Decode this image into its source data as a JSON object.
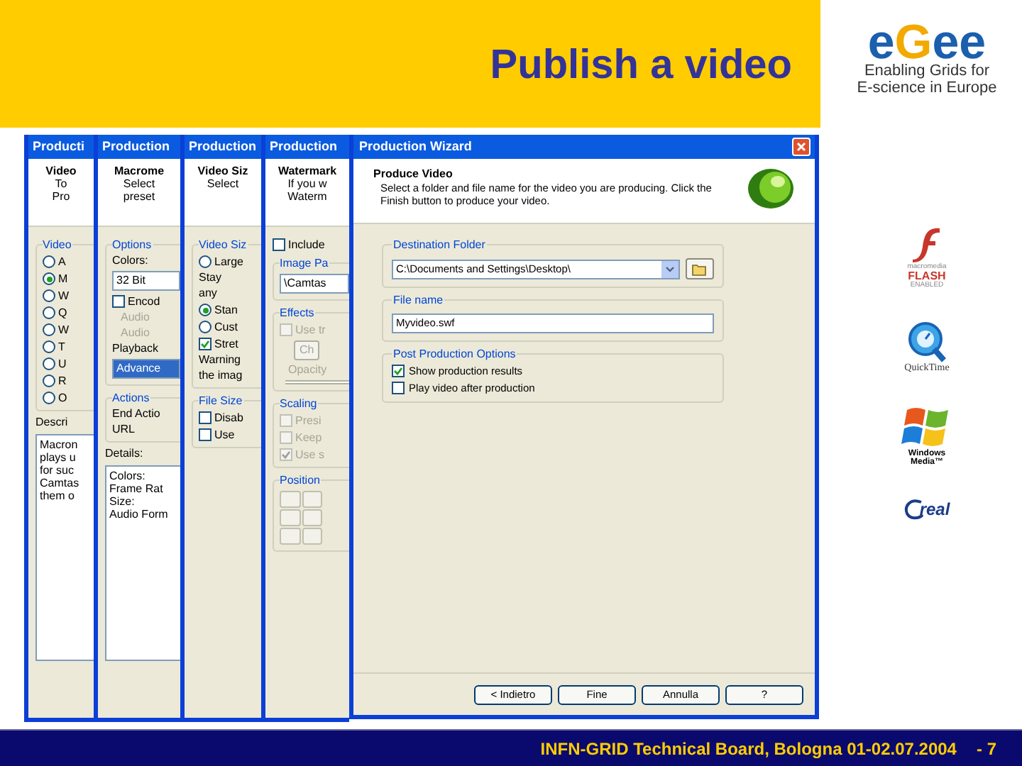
{
  "slide_title": "Publish a video",
  "back_windows": [
    {
      "title": "Producti",
      "header": [
        "Video",
        "To",
        "Pro"
      ],
      "body": [
        {
          "kind": "group",
          "label": "Video",
          "children": [
            {
              "kind": "radio",
              "label": "A",
              "selected": false
            },
            {
              "kind": "radio",
              "label": "M",
              "selected": true
            },
            {
              "kind": "radio",
              "label": "W",
              "selected": false
            },
            {
              "kind": "radio",
              "label": "Q",
              "selected": false
            },
            {
              "kind": "radio",
              "label": "W",
              "selected": false
            },
            {
              "kind": "radio",
              "label": "T",
              "selected": false
            },
            {
              "kind": "radio",
              "label": "U",
              "selected": false
            },
            {
              "kind": "radio",
              "label": "R",
              "selected": false
            },
            {
              "kind": "radio",
              "label": "O",
              "selected": false
            }
          ]
        },
        {
          "kind": "text",
          "label": "Descri"
        },
        {
          "kind": "textbox",
          "lines": [
            "Macron",
            "plays u",
            "for suc",
            "Camtas",
            "them o"
          ]
        }
      ]
    },
    {
      "title": "Production",
      "header": [
        "Macrome",
        "Select",
        "preset"
      ],
      "body": [
        {
          "kind": "group",
          "label": "Options",
          "children": [
            {
              "kind": "text",
              "label": "Colors:"
            },
            {
              "kind": "field",
              "label": "32 Bit",
              "selected": false
            },
            {
              "kind": "checkbox",
              "label": "Encod",
              "checked": false,
              "disabled": false
            },
            {
              "kind": "dimtext",
              "label": "Audio"
            },
            {
              "kind": "dimtext",
              "label": "Audio"
            },
            {
              "kind": "text",
              "label": "Playback"
            },
            {
              "kind": "field",
              "label": "Advance",
              "selected": true
            }
          ]
        },
        {
          "kind": "group",
          "label": "Actions",
          "children": [
            {
              "kind": "text",
              "label": "End Actio"
            },
            {
              "kind": "text",
              "label": "URL"
            }
          ]
        },
        {
          "kind": "text",
          "label": "Details:"
        },
        {
          "kind": "textbox",
          "lines": [
            "Colors:",
            "Frame Rat",
            "Size:",
            "Audio Form"
          ]
        }
      ]
    },
    {
      "title": "Production",
      "header": [
        "Video Siz",
        "Select"
      ],
      "body": [
        {
          "kind": "group",
          "label": "Video Siz",
          "children": [
            {
              "kind": "radio",
              "label": "Large",
              "selected": false
            },
            {
              "kind": "text",
              "label": "Stay"
            },
            {
              "kind": "text",
              "label": "any"
            },
            {
              "kind": "radio",
              "label": "Stan",
              "selected": true
            },
            {
              "kind": "radio",
              "label": "Cust",
              "selected": false
            },
            {
              "kind": "checkbox",
              "label": "Stret",
              "checked": true,
              "disabled": false
            },
            {
              "kind": "text",
              "label": "Warning"
            },
            {
              "kind": "text",
              "label": "the imag"
            }
          ]
        },
        {
          "kind": "group",
          "label": "File Size",
          "children": [
            {
              "kind": "checkbox",
              "label": "Disab",
              "checked": false,
              "disabled": false
            },
            {
              "kind": "checkbox",
              "label": "Use",
              "checked": false,
              "disabled": false
            }
          ]
        }
      ]
    },
    {
      "title": "Production",
      "header": [
        "Watermark",
        "If you w",
        "Waterm"
      ],
      "body": [
        {
          "kind": "checkbox",
          "label": "Include",
          "checked": false,
          "disabled": false
        },
        {
          "kind": "group",
          "label": "Image Pa",
          "children": [
            {
              "kind": "field",
              "label": "\\Camtas",
              "selected": false
            }
          ]
        },
        {
          "kind": "group",
          "label": "Effects",
          "children": [
            {
              "kind": "checkbox",
              "label": "Use tr",
              "checked": false,
              "disabled": true
            },
            {
              "kind": "button",
              "label": "Ch"
            },
            {
              "kind": "dimtext",
              "label": "Opacity"
            },
            {
              "kind": "slider"
            }
          ]
        },
        {
          "kind": "group",
          "label": "Scaling",
          "children": [
            {
              "kind": "checkbox",
              "label": "Presi",
              "checked": false,
              "disabled": true
            },
            {
              "kind": "checkbox",
              "label": "Keep",
              "checked": false,
              "disabled": true
            },
            {
              "kind": "checkbox",
              "label": "Use s",
              "checked": true,
              "disabled": true
            }
          ]
        },
        {
          "kind": "group",
          "label": "Position",
          "children": [
            {
              "kind": "grid"
            }
          ]
        }
      ]
    }
  ],
  "wizard": {
    "title": "Production Wizard",
    "heading": "Produce Video",
    "description": "Select a folder and file name for the video you are producing. Click the Finish button to produce your video.",
    "destination": {
      "label": "Destination Folder",
      "value": "C:\\Documents and Settings\\Desktop\\"
    },
    "file_name": {
      "label": "File name",
      "value": "Myvideo.swf"
    },
    "post_production": {
      "label": "Post Production Options",
      "options": [
        {
          "label": "Show production results",
          "checked": true
        },
        {
          "label": "Play video after production",
          "checked": false
        }
      ]
    },
    "buttons": [
      "< Indietro",
      "Fine",
      "Annulla",
      "?"
    ]
  },
  "logo": {
    "letters": [
      {
        "char": "e",
        "color": "#1b5fae"
      },
      {
        "char": "G",
        "color": "#f2a900"
      },
      {
        "char": "e",
        "color": "#1b5fae"
      },
      {
        "char": "e",
        "color": "#1b5fae"
      }
    ],
    "tagline": [
      "Enabling Grids for",
      "E-science in Europe"
    ]
  },
  "players": [
    {
      "kind": "flash",
      "lines": [
        "macromedia",
        "FLASH",
        "ENABLED"
      ]
    },
    {
      "kind": "quicktime",
      "lines": [
        "QuickTime"
      ]
    },
    {
      "kind": "windows",
      "lines": [
        "Windows",
        "Media™"
      ]
    },
    {
      "kind": "real",
      "lines": [
        "real"
      ]
    }
  ],
  "footer": {
    "text": "INFN-GRID Technical Board, Bologna 01-02.07.2004",
    "page": "- 7"
  }
}
